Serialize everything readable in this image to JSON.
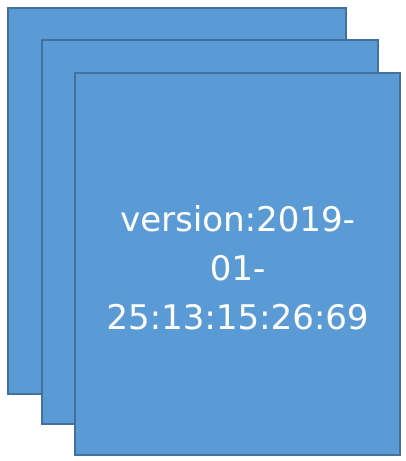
{
  "diagram": {
    "fill_color": "#5b9bd5",
    "border_color": "#41719c",
    "text_color": "#ffffff",
    "label_lines": [
      "version:2019-",
      "01-",
      "25:13:15:26:69"
    ]
  }
}
